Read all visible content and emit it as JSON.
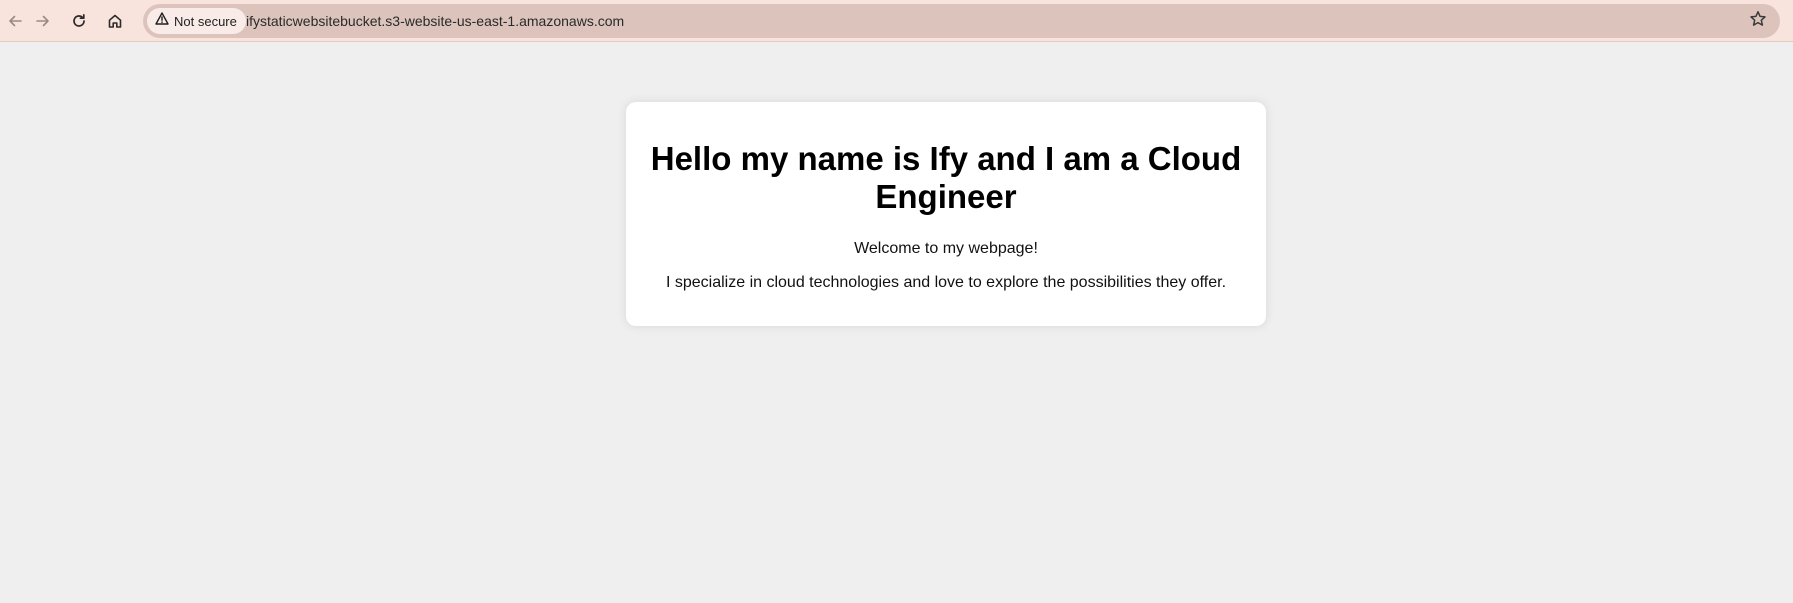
{
  "browser": {
    "nav": {
      "back_icon": "arrow-left-icon",
      "forward_icon": "arrow-right-icon",
      "reload_icon": "reload-icon",
      "home_icon": "home-icon"
    },
    "omnibox": {
      "security_label": "Not secure",
      "security_icon": "warning-triangle-icon",
      "url": "ifystaticwebsitebucket.s3-website-us-east-1.amazonaws.com",
      "bookmark_icon": "star-icon"
    },
    "colors": {
      "toolbar_bg": "#f9e4dd",
      "omnibox_bg": "#dcc4bd",
      "page_bg": "#efefef",
      "card_bg": "#ffffff"
    }
  },
  "page": {
    "heading": "Hello my name is Ify and I am a Cloud Engineer",
    "welcome": "Welcome to my webpage!",
    "specialty": "I specialize in cloud technologies and love to explore the possibilities they offer."
  }
}
